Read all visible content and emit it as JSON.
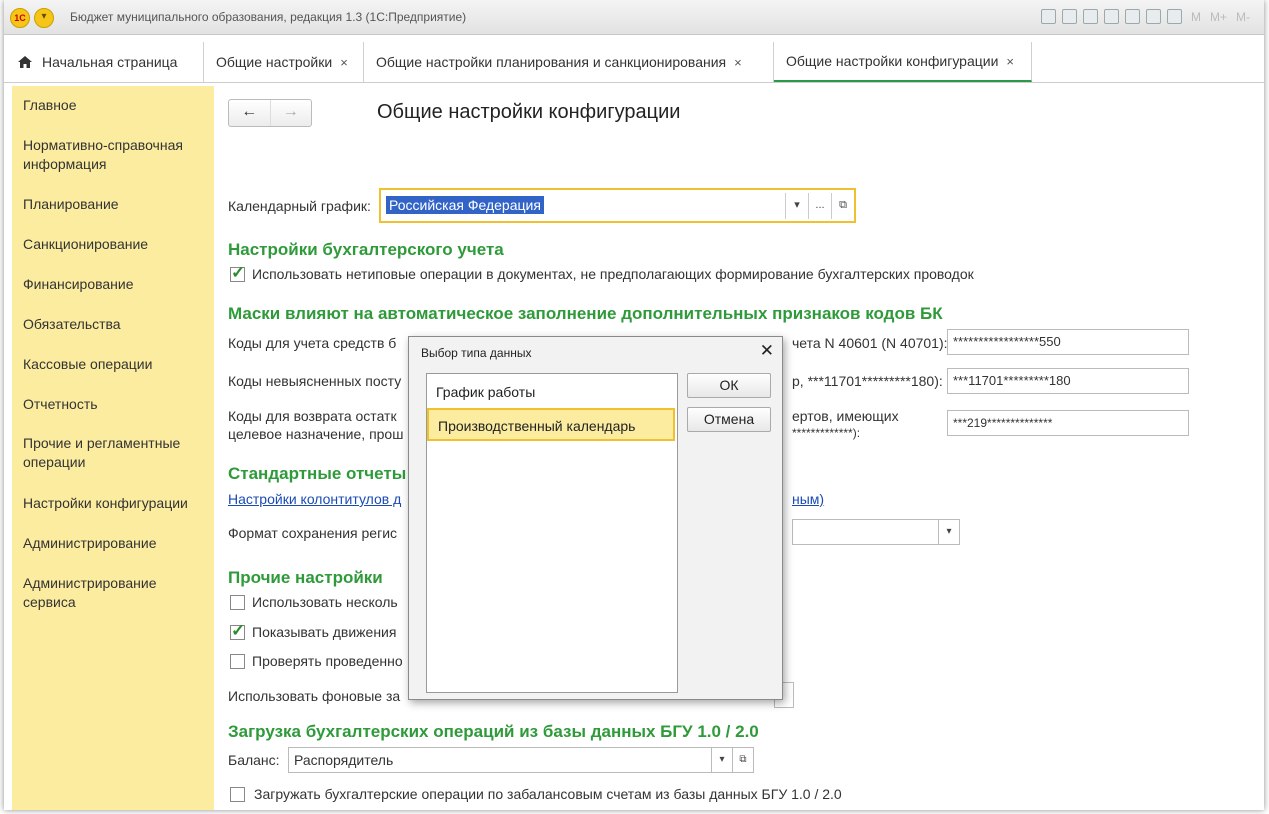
{
  "window": {
    "logo_text": "1С",
    "title": "Бюджет муниципального образования, редакция 1.3  (1С:Предприятие)",
    "toolbar_m": "M",
    "toolbar_mplus": "M+",
    "toolbar_mminus": "M-"
  },
  "tabs": [
    {
      "label": "Начальная страница"
    },
    {
      "label": "Общие настройки",
      "close": "×"
    },
    {
      "label": "Общие настройки планирования и санкционирования",
      "close": "×"
    },
    {
      "label": "Общие настройки конфигурации",
      "close": "×"
    }
  ],
  "sidebar": {
    "items": [
      {
        "label": "Главное"
      },
      {
        "label": "Нормативно-справочная информация"
      },
      {
        "label": "Планирование"
      },
      {
        "label": "Санкционирование"
      },
      {
        "label": "Финансирование"
      },
      {
        "label": "Обязательства"
      },
      {
        "label": "Кассовые операции"
      },
      {
        "label": "Отчетность"
      },
      {
        "label": "Прочие и регламентные операции"
      },
      {
        "label": "Настройки конфигурации"
      },
      {
        "label": "Администрирование"
      },
      {
        "label": "Администрирование сервиса"
      }
    ]
  },
  "main": {
    "back": "←",
    "forward": "→",
    "title": "Общие настройки конфигурации",
    "calendar_label": "Календарный график:",
    "calendar_value": "Российская Федерация",
    "calendar_dropdown": "▾",
    "calendar_more": "...",
    "calendar_open": "⧉",
    "accounting_header": "Настройки бухгалтерского учета",
    "accounting_checkbox": "Использовать нетиповые операции в документах, не предполагающих формирование бухгалтерских проводок",
    "masks_header": "Маски влияют на автоматическое заполнение дополнительных признаков кодов БК",
    "mask1_label_left": "Коды для учета средств б",
    "mask1_label_right": "чета N 40601 (N 40701):",
    "mask1_value": "*****************550",
    "mask2_label_left": "Коды невыясненных посту",
    "mask2_label_right": "р, ***11701*********180):",
    "mask2_value": "***11701*********180",
    "mask3_label_left1": "Коды для возврата остатк",
    "mask3_label_left2": "целевое назначение, прош",
    "mask3_label_right1": "ертов, имеющих",
    "mask3_label_right2": "*************):",
    "mask3_value": "***219**************",
    "reports_header": "Стандартные отчеты",
    "reports_link_left": "Настройки колонтитулов д",
    "reports_link_right": "ным)",
    "format_label": "Формат сохранения регис",
    "format_dropdown": "▾",
    "other_header": "Прочие настройки",
    "other_cb1": "Использовать несколь",
    "other_cb2": "Показывать движения",
    "other_cb3": "Проверять проведенно",
    "bg_label": "Использовать фоновые за",
    "bgu_header": "Загрузка бухгалтерских операций из базы данных БГУ 1.0 / 2.0",
    "balance_label": "Баланс:",
    "balance_value": "Распорядитель",
    "balance_dropdown": "▾",
    "balance_open": "⧉",
    "offbalance_checkbox": "Загружать бухгалтерские операции по забалансовым счетам из базы данных БГУ 1.0 / 2.0"
  },
  "dialog": {
    "title": "Выбор типа данных",
    "close": "✕",
    "items": [
      {
        "label": "График работы"
      },
      {
        "label": "Производственный календарь"
      }
    ],
    "ok": "ОК",
    "cancel": "Отмена"
  }
}
